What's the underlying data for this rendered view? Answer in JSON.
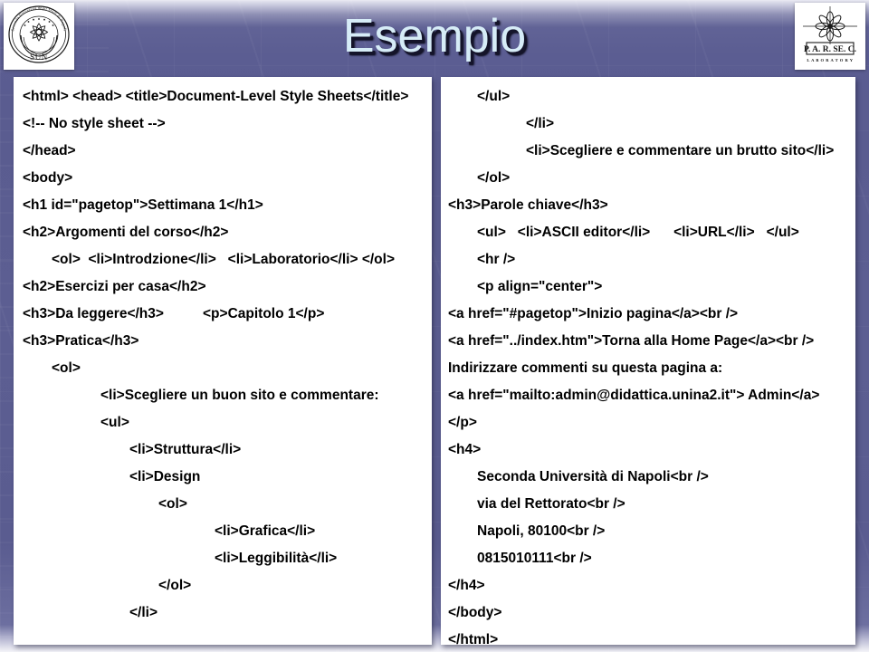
{
  "slide": {
    "title": "Esempio",
    "title_color": "#d6ecf7",
    "background_color": "#5a5c90",
    "panel_background": "#ffffff",
    "code_color": "#000000"
  },
  "logos": {
    "left": {
      "name": "sun-university-seal",
      "ring_text": "Seconda Università degli Studi di Napoli",
      "acronym": "SUN"
    },
    "right": {
      "name": "parsec-laboratory-logo",
      "acronym": "P. A. R. SE. C.",
      "subtitle": "L A B O R A T O R Y"
    }
  },
  "left_panel": {
    "lines": [
      {
        "indent": 0,
        "text": "<html> <head> <title>Document-Level Style Sheets</title>"
      },
      {
        "indent": 0,
        "text": "<!-- No style sheet -->"
      },
      {
        "indent": 0,
        "text": "</head>"
      },
      {
        "indent": 0,
        "text": "<body>"
      },
      {
        "indent": 0,
        "text": "<h1 id=\"pagetop\">Settimana 1</h1>"
      },
      {
        "indent": 0,
        "text": "<h2>Argomenti del corso</h2>"
      },
      {
        "indent": 1,
        "text": "<ol>  <li>Introdzione</li>   <li>Laboratorio</li> </ol>"
      },
      {
        "indent": 0,
        "text": "<h2>Esercizi per casa</h2>"
      },
      {
        "indent": 0,
        "text": "<h3>Da leggere</h3>          <p>Capitolo 1</p>"
      },
      {
        "indent": 0,
        "text": "<h3>Pratica</h3>"
      },
      {
        "indent": 1,
        "text": "<ol>"
      },
      {
        "indent": 3,
        "text": "<li>Scegliere un buon sito e commentare:"
      },
      {
        "indent": 3,
        "text": "<ul>"
      },
      {
        "indent": 4,
        "text": "<li>Struttura</li>"
      },
      {
        "indent": 4,
        "text": "<li>Design"
      },
      {
        "indent": 5,
        "text": "<ol>"
      },
      {
        "indent": 7,
        "text": "<li>Grafica</li>"
      },
      {
        "indent": 7,
        "text": "<li>Leggibilità</li>"
      },
      {
        "indent": 5,
        "text": "</ol>"
      },
      {
        "indent": 4,
        "text": "</li>"
      }
    ]
  },
  "right_panel": {
    "lines": [
      {
        "indent": 1,
        "text": "</ul>"
      },
      {
        "indent": 3,
        "text": "</li>"
      },
      {
        "indent": 3,
        "text": "<li>Scegliere e commentare un brutto sito</li>"
      },
      {
        "indent": 1,
        "text": "</ol>"
      },
      {
        "indent": 0,
        "text": "<h3>Parole chiave</h3>"
      },
      {
        "indent": 1,
        "text": "<ul>   <li>ASCII editor</li>      <li>URL</li>   </ul>"
      },
      {
        "indent": 1,
        "text": "<hr />"
      },
      {
        "indent": 1,
        "text": "<p align=\"center\">"
      },
      {
        "indent": 0,
        "text": "<a href=\"#pagetop\">Inizio pagina</a><br />"
      },
      {
        "indent": 0,
        "text": "<a href=\"../index.htm\">Torna alla Home Page</a><br />"
      },
      {
        "indent": 0,
        "text": "Indirizzare commenti su questa pagina a:"
      },
      {
        "indent": 0,
        "text": "<a href=\"mailto:admin@didattica.unina2.it\"> Admin</a>"
      },
      {
        "indent": 0,
        "text": "</p>"
      },
      {
        "indent": 0,
        "text": "<h4>"
      },
      {
        "indent": 1,
        "text": "Seconda Università di Napoli<br />"
      },
      {
        "indent": 1,
        "text": "via del Rettorato<br />"
      },
      {
        "indent": 1,
        "text": "Napoli, 80100<br />"
      },
      {
        "indent": 1,
        "text": "0815010111<br />"
      },
      {
        "indent": 0,
        "text": "</h4>"
      },
      {
        "indent": 0,
        "text": "</body>"
      },
      {
        "indent": 0,
        "text": "</html>"
      }
    ]
  }
}
